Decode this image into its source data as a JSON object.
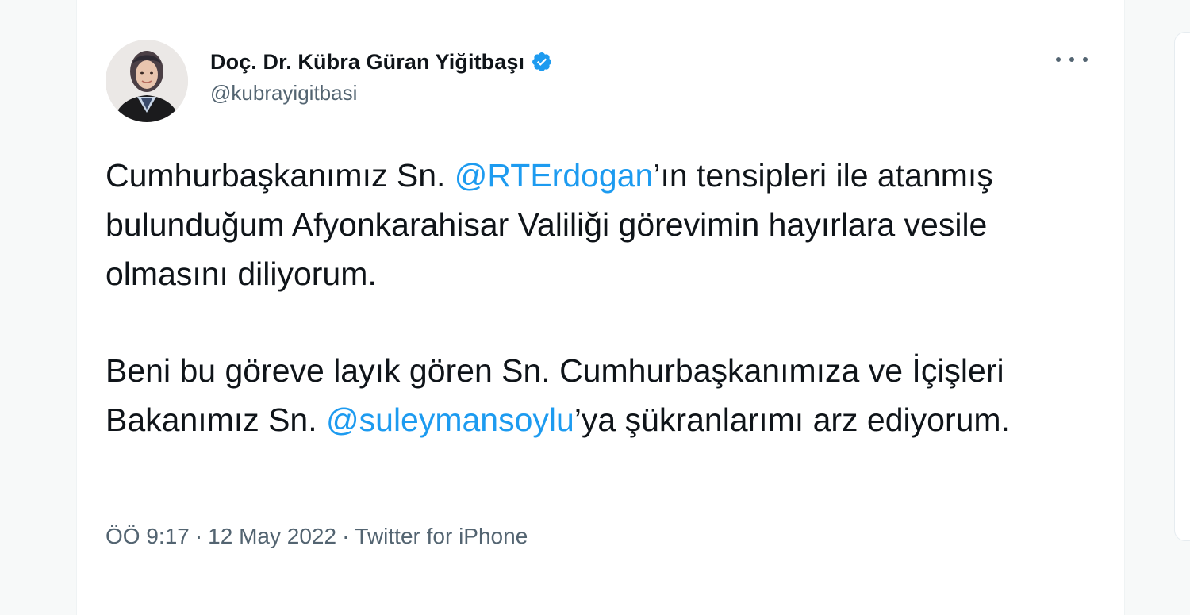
{
  "tweet": {
    "author": {
      "display_name": "Doç. Dr. Kübra Güran Yiğitbaşı",
      "handle": "@kubrayigitbasi",
      "verified": true
    },
    "paragraph1": {
      "part1": "Cumhurbaşkanımız Sn. ",
      "mention": "@RTErdogan",
      "part2": "’ın tensipleri ile atanmış bulunduğum Afyonkarahisar Valiliği görevimin hayırlara vesile olmasını diliyorum."
    },
    "paragraph2": {
      "part1": "Beni bu göreve layık gören Sn. Cumhurbaşkanımıza ve İçişleri Bakanımız Sn. ",
      "mention": "@suleymansoylu",
      "part2": "’ya şükranlarımı arz ediyorum."
    },
    "meta": {
      "time": "ÖÖ 9:17",
      "separator": "·",
      "date": "12 May 2022",
      "source": "Twitter for iPhone"
    }
  },
  "colors": {
    "link": "#1d9bf0",
    "text": "#0f1419",
    "secondary": "#536471",
    "verified": "#1d9bf0"
  },
  "icons": {
    "verified": "verified-badge-icon",
    "more": "more-dots-icon"
  }
}
